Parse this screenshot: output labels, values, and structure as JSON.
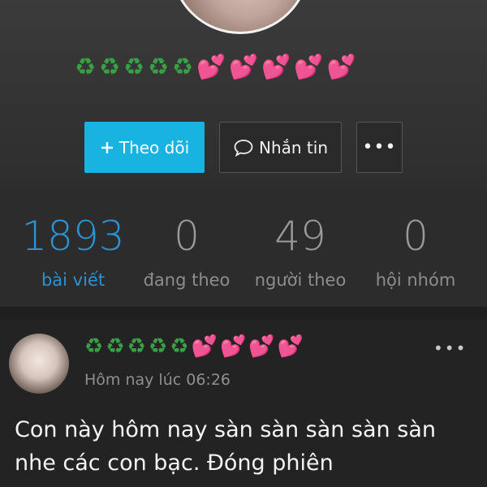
{
  "profile": {
    "name_emoji": "♻♻♻♻♻💕💕💕💕💕"
  },
  "actions": {
    "follow_label": "Theo dõi",
    "message_label": "Nhắn tin",
    "more_label": "•••"
  },
  "stats": [
    {
      "value": "1893",
      "label": "bài viết"
    },
    {
      "value": "0",
      "label": "đang theo"
    },
    {
      "value": "49",
      "label": "người theo"
    },
    {
      "value": "0",
      "label": "hội nhóm"
    }
  ],
  "post": {
    "author_emoji": "♻♻♻♻♻💕💕💕💕",
    "time": "Hôm nay lúc 06:26",
    "more_label": "•••",
    "text": "Con này hôm nay sàn sàn sàn sàn sàn nhe các con bạc.  Đóng phiên"
  },
  "colors": {
    "accent": "#18b3e0",
    "active_stat": "#2b93d3"
  }
}
